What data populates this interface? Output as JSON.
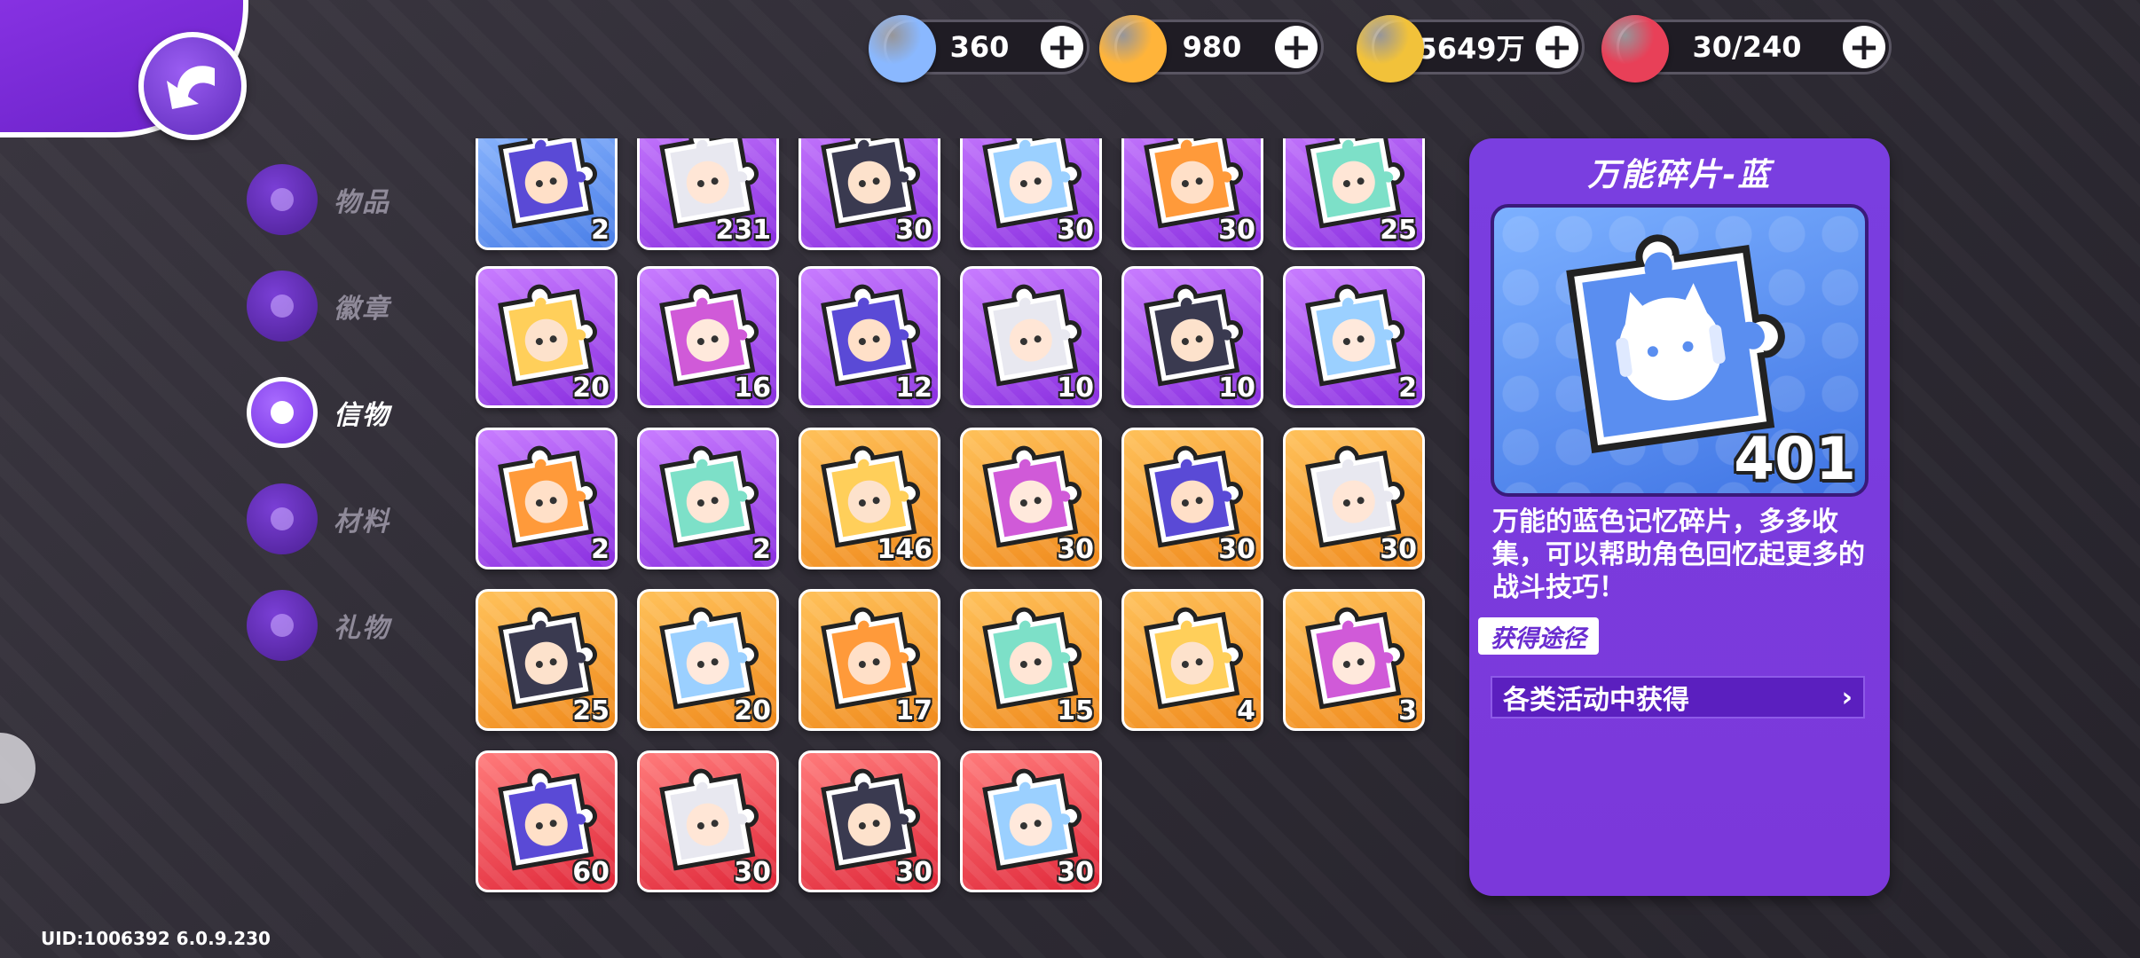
{
  "currencies": [
    {
      "name": "gem",
      "icon": "rainbow-cat-gem-icon",
      "value": "360",
      "color": "#8ab8ff"
    },
    {
      "name": "cat-coin",
      "icon": "gold-cat-icon",
      "value": "980",
      "color": "#ffb43a"
    },
    {
      "name": "gold",
      "icon": "gold-coin-icon",
      "value": "5649万",
      "color": "#f2c23a"
    },
    {
      "name": "stamina",
      "icon": "cake-icon",
      "value": "30/240",
      "color": "#e84058"
    }
  ],
  "sidebar": {
    "items": [
      {
        "label": "物品",
        "icon": "cat-bag-icon",
        "active": false
      },
      {
        "label": "徽章",
        "icon": "badge-icon",
        "active": false
      },
      {
        "label": "信物",
        "icon": "token-icon",
        "active": true
      },
      {
        "label": "材料",
        "icon": "tag-icon",
        "active": false
      },
      {
        "label": "礼物",
        "icon": "gift-icon",
        "active": false
      }
    ]
  },
  "items": [
    {
      "rarity": "blue",
      "count": "2"
    },
    {
      "rarity": "purple",
      "count": "231"
    },
    {
      "rarity": "purple",
      "count": "30"
    },
    {
      "rarity": "purple",
      "count": "30"
    },
    {
      "rarity": "purple",
      "count": "30"
    },
    {
      "rarity": "purple",
      "count": "25"
    },
    {
      "rarity": "purple",
      "count": "20"
    },
    {
      "rarity": "purple",
      "count": "16"
    },
    {
      "rarity": "purple",
      "count": "12"
    },
    {
      "rarity": "purple",
      "count": "10"
    },
    {
      "rarity": "purple",
      "count": "10"
    },
    {
      "rarity": "purple",
      "count": "2"
    },
    {
      "rarity": "purple",
      "count": "2"
    },
    {
      "rarity": "purple",
      "count": "2"
    },
    {
      "rarity": "orange",
      "count": "146"
    },
    {
      "rarity": "orange",
      "count": "30"
    },
    {
      "rarity": "orange",
      "count": "30"
    },
    {
      "rarity": "orange",
      "count": "30"
    },
    {
      "rarity": "orange",
      "count": "25"
    },
    {
      "rarity": "orange",
      "count": "20"
    },
    {
      "rarity": "orange",
      "count": "17"
    },
    {
      "rarity": "orange",
      "count": "15"
    },
    {
      "rarity": "orange",
      "count": "4"
    },
    {
      "rarity": "orange",
      "count": "3"
    },
    {
      "rarity": "red",
      "count": "60"
    },
    {
      "rarity": "red",
      "count": "30"
    },
    {
      "rarity": "red",
      "count": "30"
    },
    {
      "rarity": "red",
      "count": "30"
    }
  ],
  "detail": {
    "title": "万能碎片-蓝",
    "count": "401",
    "description": "万能的蓝色记忆碎片，多多收集，可以帮助角色回忆起更多的战斗技巧！",
    "source_label": "获得途径",
    "source": "各类活动中获得"
  },
  "footer": {
    "uid": "UID:1006392 6.0.9.230"
  }
}
